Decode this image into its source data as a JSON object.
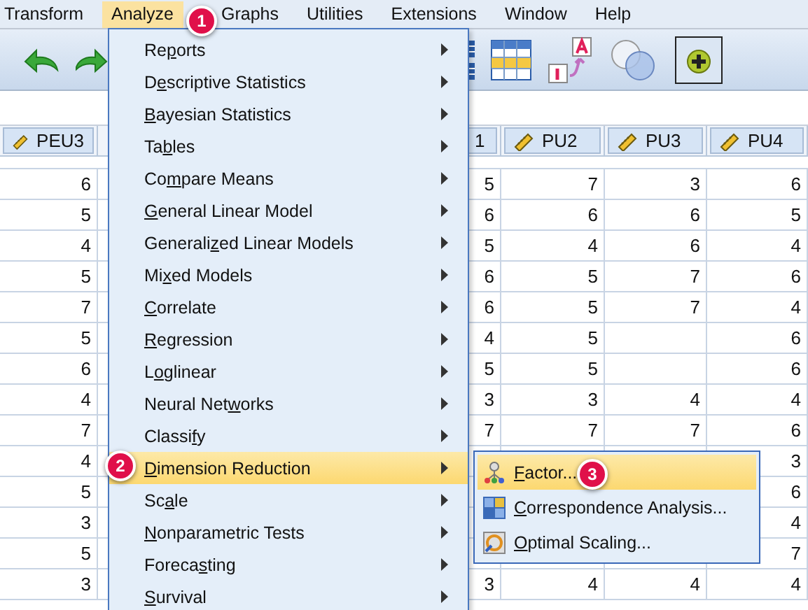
{
  "menubar": [
    {
      "label": "Transform",
      "selected": false
    },
    {
      "label": "Analyze",
      "selected": true
    },
    {
      "label": "Graphs",
      "selected": false
    },
    {
      "label": "Utilities",
      "selected": false
    },
    {
      "label": "Extensions",
      "selected": false
    },
    {
      "label": "Window",
      "selected": false
    },
    {
      "label": "Help",
      "selected": false
    }
  ],
  "table": {
    "columns": [
      {
        "label": "PEU3",
        "kind": "scale"
      },
      {
        "kind": "hidden"
      },
      {
        "label": "1",
        "kind": "plain"
      },
      {
        "label": "PU2",
        "kind": "scale"
      },
      {
        "label": "PU3",
        "kind": "scale"
      },
      {
        "label": "PU4",
        "kind": "scale"
      }
    ],
    "rows": [
      [
        "6",
        null,
        "5",
        "7",
        "3",
        "6"
      ],
      [
        "5",
        null,
        "6",
        "6",
        "6",
        "5"
      ],
      [
        "4",
        null,
        "5",
        "4",
        "6",
        "4"
      ],
      [
        "5",
        null,
        "6",
        "5",
        "7",
        "6"
      ],
      [
        "7",
        null,
        "6",
        "5",
        "7",
        "4"
      ],
      [
        "5",
        null,
        "4",
        "5",
        null,
        "6"
      ],
      [
        "6",
        null,
        "5",
        "5",
        null,
        "6"
      ],
      [
        "4",
        null,
        "3",
        "3",
        "4",
        "4"
      ],
      [
        "7",
        null,
        "7",
        "7",
        "7",
        "6"
      ],
      [
        "4",
        null,
        null,
        null,
        null,
        "3"
      ],
      [
        "5",
        null,
        null,
        null,
        null,
        "6"
      ],
      [
        "3",
        null,
        null,
        null,
        null,
        "4"
      ],
      [
        "5",
        null,
        null,
        null,
        null,
        "7"
      ],
      [
        "3",
        null,
        "3",
        "4",
        "4",
        "4"
      ]
    ]
  },
  "analyze_menu": {
    "items": [
      {
        "label": {
          "pre": "Re",
          "key": "p",
          "post": "orts"
        },
        "selected": false
      },
      {
        "label": {
          "pre": "D",
          "key": "e",
          "post": "scriptive Statistics"
        },
        "selected": false
      },
      {
        "label": {
          "key": "B",
          "post": "ayesian Statistics"
        },
        "selected": false
      },
      {
        "label": {
          "pre": "Ta",
          "key": "b",
          "post": "les"
        },
        "selected": false
      },
      {
        "label": {
          "pre": "Co",
          "key": "m",
          "post": "pare Means"
        },
        "selected": false
      },
      {
        "label": {
          "key": "G",
          "post": "eneral Linear Model"
        },
        "selected": false
      },
      {
        "label": {
          "pre": "Generali",
          "key": "z",
          "post": "ed Linear Models"
        },
        "selected": false
      },
      {
        "label": {
          "pre": "Mi",
          "key": "x",
          "post": "ed Models"
        },
        "selected": false
      },
      {
        "label": {
          "key": "C",
          "post": "orrelate"
        },
        "selected": false
      },
      {
        "label": {
          "key": "R",
          "post": "egression"
        },
        "selected": false
      },
      {
        "label": {
          "pre": "L",
          "key": "o",
          "post": "glinear"
        },
        "selected": false
      },
      {
        "label": {
          "pre": "Neural Net",
          "key": "w",
          "post": "orks"
        },
        "selected": false
      },
      {
        "label": {
          "pre": "Classi",
          "key": "f",
          "post": "y"
        },
        "selected": false
      },
      {
        "label": {
          "key": "D",
          "post": "imension Reduction"
        },
        "selected": true
      },
      {
        "label": {
          "pre": "Sc",
          "key": "a",
          "post": "le"
        },
        "selected": false
      },
      {
        "label": {
          "key": "N",
          "post": "onparametric Tests"
        },
        "selected": false
      },
      {
        "label": {
          "pre": "Foreca",
          "key": "s",
          "post": "ting"
        },
        "selected": false
      },
      {
        "label": {
          "key": "S",
          "post": "urvival"
        },
        "selected": false
      }
    ]
  },
  "submenu": {
    "items": [
      {
        "label": {
          "key": "F",
          "post": "actor..."
        },
        "kind": "factor",
        "selected": true
      },
      {
        "label": {
          "key": "C",
          "post": "orrespondence Analysis..."
        },
        "kind": "correspondence",
        "selected": false
      },
      {
        "label": {
          "key": "O",
          "post": "ptimal Scaling..."
        },
        "kind": "scaling",
        "selected": false
      }
    ]
  },
  "step_badges": [
    "1",
    "2",
    "3"
  ]
}
